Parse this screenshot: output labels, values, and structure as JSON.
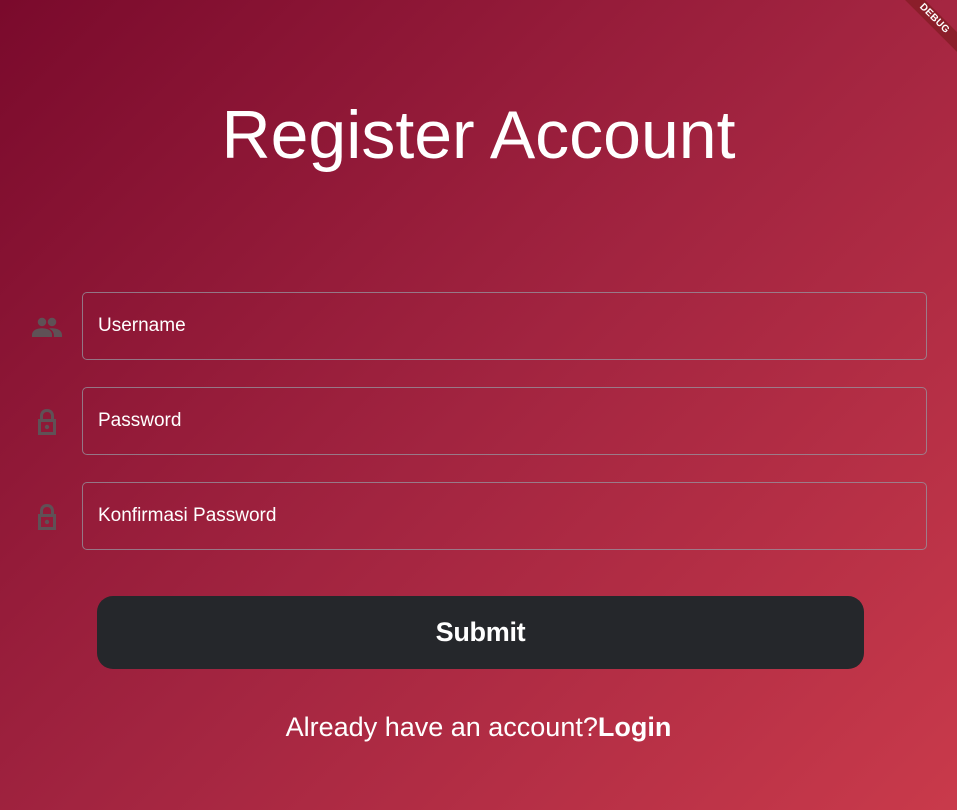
{
  "debug_banner": {
    "label": "DEBUG"
  },
  "title": "Register Account",
  "fields": [
    {
      "icon": "people-icon",
      "placeholder": "Username",
      "value": ""
    },
    {
      "icon": "lock-icon",
      "placeholder": "Password",
      "value": ""
    },
    {
      "icon": "lock-icon",
      "placeholder": "Konfirmasi Password",
      "value": ""
    }
  ],
  "submit": {
    "label": "Submit"
  },
  "footer": {
    "prompt": "Already have an account?",
    "login_label": "Login"
  },
  "colors": {
    "gradient_start": "#7a0a2c",
    "gradient_end": "#c93a4b",
    "button_bg": "#25272b",
    "icon": "#5f5156",
    "text": "#ffffff"
  }
}
